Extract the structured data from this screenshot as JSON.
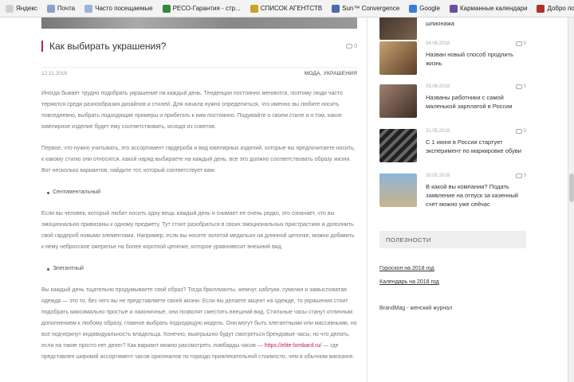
{
  "bookmarks": [
    {
      "label": "Яндекс",
      "icon": "yandex-icon",
      "color": "#d0d0d0"
    },
    {
      "label": "Почта",
      "icon": "mail-icon",
      "color": "#8aa2c8"
    },
    {
      "label": "Часто посещаемые",
      "icon": "frequent-icon",
      "color": "#9ab4d4"
    },
    {
      "label": "РЕСО-Гарантия - стр...",
      "icon": "reso-icon",
      "color": "#2e8b3a"
    },
    {
      "label": "СПИСОК АГЕНТСТВ",
      "icon": "list-icon",
      "color": "#c9a227"
    },
    {
      "label": "Sun™ Convergence",
      "icon": "sun-icon",
      "color": "#4e6aa8"
    },
    {
      "label": "Google",
      "icon": "google-icon",
      "color": "#3d7bd9"
    },
    {
      "label": "Карманные календари",
      "icon": "calendar-icon",
      "color": "#6b4fa3"
    },
    {
      "label": "Добро пожаловать в...",
      "icon": "welcome-icon",
      "color": "#b03030"
    }
  ],
  "article": {
    "title": "Как выбирать украшения?",
    "comments": "0",
    "date": "12.11.2018",
    "tags": "МОДА, УКРАШЕНИЯ",
    "p1": "Иногда бывает трудно подобрать украшение на каждый день. Тенденции постоянно меняются, поэтому люди часто теряются среди разнообразия дизайнов и стилей. Для начала нужно определиться, что именно вы любите носить повседневно, выбрать подходящие примеры и прибегать к ним постоянно. Подумайте о своем стиле и о том, какое ювелирное изделие будет ему соответствовать, исходя из советов.",
    "p2": "Первое, что нужно учитывать, это ассортимент гардероба и вид ювелирных изделий, которые вы предпочитаете носить, к какому стилю они относятся, какой наряд выбираете на каждый день, все это должно соответствовать образу жизни. Вот несколько вариантов, найдите тот, который соответствует вам:",
    "b1": "Сентиментальный",
    "p3": "Если вы человек, который любит носить одну вещь каждый день и снимает ее очень редко, это означает, что вы эмоционально привязаны к одному предмету. Тут стоит разобраться в своих эмоциональных пристрастиях и дополнить свой гардероб новыми элементами. Например, если вы носите золотой медальон на длинной цепочке, можно добавить к нему небросское ожерелье на более короткой цепочке, которое уравновесит внешний вид.",
    "b2": "Элегантный",
    "p4a": "Вы каждый день тщательно продумываете свой образ? Тогда бриллианты, жемчуг, каблуки, сумочки и замысловатая одежда — это то, без чего вы не представляете своей жизни. Если вы делаете акцент на одежде, то украшения стоит подобрать максимально простые и лаконичные, они позволят сместить внешний вид. Стильные часы станут отличным дополнением к любому образу, главное выбрать подходящую модель. Они могут быть элегантными или массивными, но все подчеркнут индивидуальность владельца. Конечно, выигрышно будут смотреться брендовые часы, но что делать, если на такие просто нет денег? Как вариант можно рассмотреть ломбарды часов — ",
    "link": "https://elite-lombard.ru/",
    "p4b": " — где представлен широкий ассортимент часов оригиналов по гораздо привлекательной стоимости, чем в обычном магазине."
  },
  "sidebar": {
    "posts": [
      {
        "date": "",
        "comments": "",
        "title": "шпионажа",
        "thumb": "#5b4a3a"
      },
      {
        "date": "04.06.2018",
        "comments": "0",
        "title": "Назван новый способ продлить жизнь",
        "thumb": "#8a6a45"
      },
      {
        "date": "03.06.2018",
        "comments": "0",
        "title": "Названы работники с самой маленькой зарплатой в России",
        "thumb": "#6b5344"
      },
      {
        "date": "31.05.2018",
        "comments": "0",
        "title": "С 1 июня в России стартует эксперимент по маркировке обуви",
        "thumb": "#3a3a3a"
      },
      {
        "date": "30.05.2018",
        "comments": "0",
        "title": "В какой вы компании? Подать заявление на отпуск за казенный счет можно уже сейчас",
        "thumb": "#7a9ab8"
      }
    ],
    "section_title": "ПОЛЕЗНОСТИ",
    "links": [
      "Гороскоп на 2018 год",
      "Календарь на 2018 год"
    ],
    "footer_text": "BrandMag - женский журнал"
  }
}
